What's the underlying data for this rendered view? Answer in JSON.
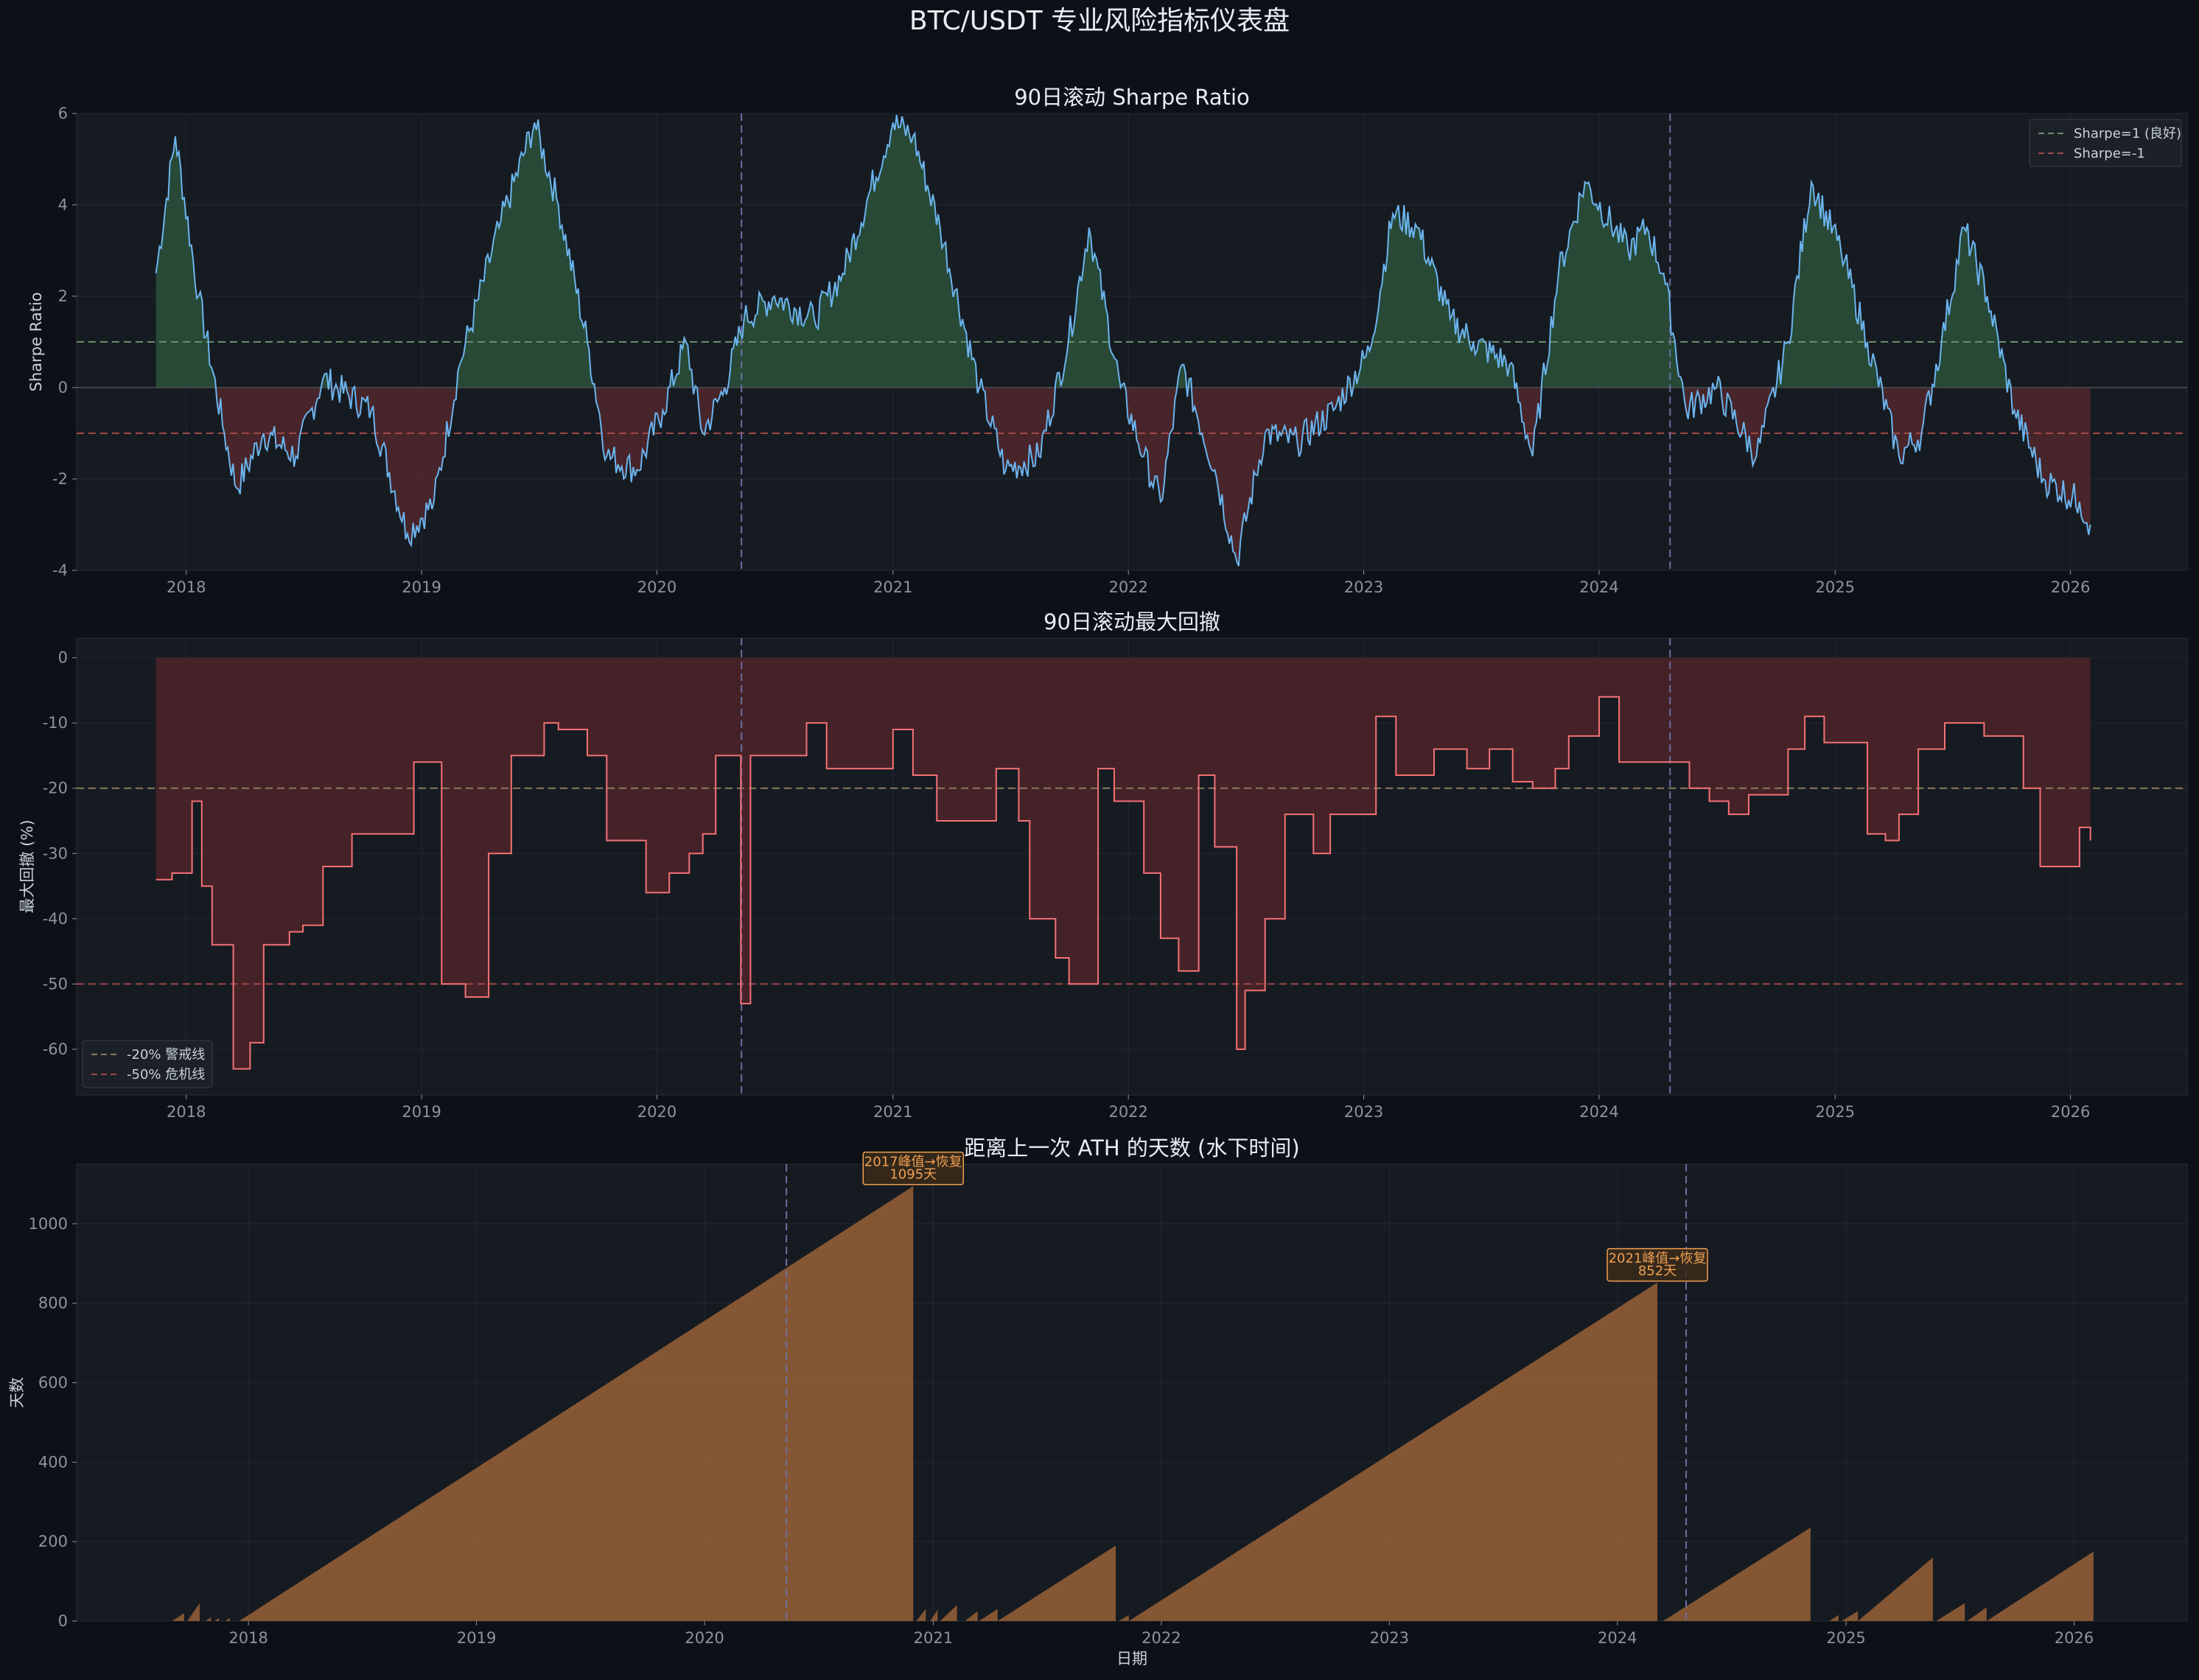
{
  "title": "BTC/USDT 专业风险指标仪表盘",
  "events": [
    "2020-05-11",
    "2024-04-20"
  ],
  "panels": {
    "sharpe": {
      "title": "90日滚动 Sharpe Ratio",
      "ylabel": "Sharpe Ratio",
      "legend": [
        "Sharpe=1 (良好)",
        "Sharpe=-1"
      ]
    },
    "drawdown": {
      "title": "90日滚动最大回撤",
      "ylabel": "最大回撤 (%)",
      "legend": [
        "-20% 警戒线",
        "-50% 危机线"
      ]
    },
    "underwater": {
      "title": "距离上一次 ATH 的天数 (水下时间)",
      "ylabel": "天数",
      "xlabel": "日期",
      "annotations": [
        {
          "line1": "2017峰值→恢复",
          "line2": "1095天",
          "x": "2020-11-30",
          "y": 1095
        },
        {
          "line1": "2021峰值→恢复",
          "line2": "852天",
          "x": "2024-03-05",
          "y": 852
        }
      ]
    }
  },
  "colors": {
    "background": "#0d1117",
    "panel": "#161b22",
    "sharpe_line": "#6cb4ee",
    "positive_fill": "#2d5a3d",
    "negative_fill": "#5a2a2e",
    "drawdown_line": "#f47174",
    "drawdown_fill": "#4a2328",
    "underwater_fill": "#8b5a35",
    "threshold_good": "#6a8f6a",
    "threshold_bad": "#a04848",
    "warning": "#8a7a60",
    "event_line": "#6e6ea0",
    "annotation": "#f0a050"
  },
  "chart_data": [
    {
      "type": "line",
      "title": "90日滚动 Sharpe Ratio",
      "ylabel": "Sharpe Ratio",
      "ylim": [
        -4,
        6
      ],
      "yticks": [
        -4,
        -2,
        0,
        2,
        4,
        6
      ],
      "xlim": [
        "2017-07-15",
        "2026-07-01"
      ],
      "xticks": [
        "2018",
        "2019",
        "2020",
        "2021",
        "2022",
        "2023",
        "2024",
        "2025",
        "2026"
      ],
      "hlines": [
        1,
        -1
      ],
      "legend_position": "top-right",
      "series": [
        {
          "name": "Sharpe",
          "x": [
            "2017-11-15",
            "2017-12-15",
            "2018-01-20",
            "2018-03-01",
            "2018-03-20",
            "2018-05-01",
            "2018-06-20",
            "2018-08-01",
            "2018-10-15",
            "2018-12-10",
            "2019-01-20",
            "2019-03-01",
            "2019-05-01",
            "2019-06-25",
            "2019-08-01",
            "2019-09-15",
            "2019-10-15",
            "2019-12-01",
            "2020-01-10",
            "2020-02-15",
            "2020-03-12",
            "2020-04-15",
            "2020-05-15",
            "2020-07-01",
            "2020-09-01",
            "2020-10-15",
            "2021-01-01",
            "2021-02-01",
            "2021-03-15",
            "2021-05-15",
            "2021-06-25",
            "2021-08-15",
            "2021-09-30",
            "2021-11-01",
            "2021-12-20",
            "2022-01-25",
            "2022-02-20",
            "2022-03-25",
            "2022-05-15",
            "2022-06-18",
            "2022-08-01",
            "2022-09-20",
            "2022-11-15",
            "2023-01-10",
            "2023-02-15",
            "2023-03-25",
            "2023-05-15",
            "2023-06-20",
            "2023-08-15",
            "2023-09-20",
            "2023-10-30",
            "2023-12-10",
            "2024-02-15",
            "2024-03-15",
            "2024-04-10",
            "2024-05-15",
            "2024-07-01",
            "2024-09-01",
            "2024-10-20",
            "2024-11-25",
            "2025-01-10",
            "2025-02-20",
            "2025-04-10",
            "2025-05-15",
            "2025-06-15",
            "2025-07-20",
            "2025-08-25",
            "2025-10-06",
            "2025-11-20",
            "2026-01-15",
            "2026-02-01"
          ],
          "values": [
            2.5,
            5.5,
            2.0,
            -1.0,
            -2.2,
            -1.0,
            -1.5,
            0.2,
            -0.5,
            -3.2,
            -2.5,
            0.5,
            3.5,
            5.8,
            4.0,
            1.0,
            -1.5,
            -1.8,
            -0.5,
            1.0,
            -1.0,
            0.0,
            1.5,
            2.0,
            1.5,
            2.5,
            5.8,
            5.5,
            3.5,
            0.0,
            -1.8,
            -1.5,
            1.0,
            3.5,
            0.0,
            -1.5,
            -2.5,
            0.5,
            -1.8,
            -3.8,
            -1.0,
            -1.2,
            -0.5,
            0.8,
            3.8,
            3.5,
            1.5,
            1.0,
            0.5,
            -1.5,
            2.5,
            4.5,
            3.0,
            3.5,
            2.5,
            -0.5,
            0.0,
            -1.5,
            1.0,
            4.5,
            3.0,
            1.0,
            -1.5,
            -1.0,
            1.0,
            3.5,
            2.0,
            -0.5,
            -2.0,
            -2.5,
            -3.0
          ]
        }
      ]
    },
    {
      "type": "area",
      "title": "90日滚动最大回撤",
      "ylabel": "最大回撤 (%)",
      "ylim": [
        -67,
        3
      ],
      "yticks": [
        -60,
        -50,
        -40,
        -30,
        -20,
        -10,
        0
      ],
      "xlim": [
        "2017-07-15",
        "2026-07-01"
      ],
      "xticks": [
        "2018",
        "2019",
        "2020",
        "2021",
        "2022",
        "2023",
        "2024",
        "2025",
        "2026"
      ],
      "hlines": [
        -20,
        -50
      ],
      "legend_position": "bottom-left",
      "series": [
        {
          "name": "最大回撤",
          "x": [
            "2017-11-15",
            "2017-12-10",
            "2018-01-10",
            "2018-01-25",
            "2018-02-10",
            "2018-03-15",
            "2018-04-10",
            "2018-05-01",
            "2018-06-10",
            "2018-07-01",
            "2018-08-01",
            "2018-09-15",
            "2018-10-20",
            "2018-11-20",
            "2018-12-20",
            "2019-02-01",
            "2019-03-10",
            "2019-04-15",
            "2019-05-20",
            "2019-07-10",
            "2019-08-01",
            "2019-09-15",
            "2019-10-15",
            "2019-11-20",
            "2019-12-15",
            "2020-01-20",
            "2020-02-20",
            "2020-03-12",
            "2020-04-01",
            "2020-05-10",
            "2020-05-25",
            "2020-07-20",
            "2020-08-20",
            "2020-09-20",
            "2020-10-20",
            "2020-11-20",
            "2021-01-01",
            "2021-02-01",
            "2021-03-10",
            "2021-04-10",
            "2021-05-10",
            "2021-06-10",
            "2021-07-15",
            "2021-08-01",
            "2021-09-10",
            "2021-10-01",
            "2021-11-15",
            "2021-12-10",
            "2022-01-25",
            "2022-02-20",
            "2022-03-20",
            "2022-04-20",
            "2022-05-15",
            "2022-06-18",
            "2022-07-01",
            "2022-08-01",
            "2022-09-01",
            "2022-10-15",
            "2022-11-10",
            "2022-12-10",
            "2023-01-20",
            "2023-02-20",
            "2023-03-20",
            "2023-04-20",
            "2023-06-10",
            "2023-07-15",
            "2023-08-20",
            "2023-09-20",
            "2023-10-25",
            "2023-11-15",
            "2024-01-01",
            "2024-02-01",
            "2024-03-05",
            "2024-04-20",
            "2024-05-20",
            "2024-06-20",
            "2024-07-20",
            "2024-08-20",
            "2024-09-20",
            "2024-10-20",
            "2024-11-15",
            "2024-12-15",
            "2025-01-20",
            "2025-02-20",
            "2025-03-20",
            "2025-04-10",
            "2025-05-10",
            "2025-06-20",
            "2025-07-15",
            "2025-08-20",
            "2025-09-20",
            "2025-10-20",
            "2025-11-15",
            "2025-12-10",
            "2026-01-15",
            "2026-02-01"
          ],
          "values": [
            -34,
            -33,
            -22,
            -35,
            -44,
            -63,
            -59,
            -44,
            -42,
            -41,
            -32,
            -27,
            -27,
            -27,
            -16,
            -50,
            -52,
            -30,
            -15,
            -10,
            -11,
            -15,
            -28,
            -28,
            -36,
            -33,
            -30,
            -27,
            -15,
            -53,
            -15,
            -15,
            -10,
            -17,
            -17,
            -17,
            -11,
            -18,
            -25,
            -25,
            -25,
            -17,
            -25,
            -40,
            -46,
            -50,
            -17,
            -22,
            -33,
            -43,
            -48,
            -18,
            -29,
            -60,
            -51,
            -40,
            -24,
            -30,
            -24,
            -24,
            -9,
            -18,
            -18,
            -14,
            -17,
            -14,
            -19,
            -20,
            -17,
            -12,
            -6,
            -16,
            -16,
            -16,
            -20,
            -22,
            -24,
            -21,
            -21,
            -14,
            -9,
            -13,
            -13,
            -27,
            -28,
            -24,
            -14,
            -10,
            -10,
            -12,
            -12,
            -20,
            -32,
            -32,
            -26,
            -28
          ]
        }
      ]
    },
    {
      "type": "area",
      "title": "距离上一次 ATH 的天数 (水下时间)",
      "xlabel": "日期",
      "ylabel": "天数",
      "ylim": [
        0,
        1150
      ],
      "yticks": [
        0,
        200,
        400,
        600,
        800,
        1000
      ],
      "xlim": [
        "2017-04-01",
        "2026-07-01"
      ],
      "xticks": [
        "2018",
        "2019",
        "2020",
        "2021",
        "2022",
        "2023",
        "2024",
        "2025",
        "2026"
      ],
      "segments": [
        {
          "start": "2017-09-01",
          "end": "2017-09-20",
          "peak": 20
        },
        {
          "start": "2017-09-25",
          "end": "2017-10-15",
          "peak": 45
        },
        {
          "start": "2017-10-25",
          "end": "2017-11-02",
          "peak": 10
        },
        {
          "start": "2017-11-08",
          "end": "2017-11-15",
          "peak": 8
        },
        {
          "start": "2017-11-25",
          "end": "2017-12-02",
          "peak": 8
        },
        {
          "start": "2017-12-17",
          "end": "2020-11-30",
          "peak": 1095
        },
        {
          "start": "2020-12-05",
          "end": "2020-12-20",
          "peak": 30
        },
        {
          "start": "2020-12-27",
          "end": "2021-01-08",
          "peak": 28
        },
        {
          "start": "2021-01-12",
          "end": "2021-02-08",
          "peak": 40
        },
        {
          "start": "2021-02-21",
          "end": "2021-03-13",
          "peak": 25
        },
        {
          "start": "2021-03-15",
          "end": "2021-04-14",
          "peak": 30
        },
        {
          "start": "2021-04-14",
          "end": "2021-10-20",
          "peak": 190
        },
        {
          "start": "2021-10-25",
          "end": "2021-11-10",
          "peak": 15
        },
        {
          "start": "2021-11-10",
          "end": "2024-03-05",
          "peak": 852
        },
        {
          "start": "2024-03-14",
          "end": "2024-11-05",
          "peak": 235
        },
        {
          "start": "2024-12-05",
          "end": "2024-12-20",
          "peak": 15
        },
        {
          "start": "2024-12-25",
          "end": "2025-01-20",
          "peak": 25
        },
        {
          "start": "2025-01-20",
          "end": "2025-05-20",
          "peak": 160
        },
        {
          "start": "2025-05-25",
          "end": "2025-07-10",
          "peak": 45
        },
        {
          "start": "2025-07-14",
          "end": "2025-08-14",
          "peak": 35
        },
        {
          "start": "2025-08-14",
          "end": "2026-02-01",
          "peak": 175
        }
      ]
    }
  ]
}
